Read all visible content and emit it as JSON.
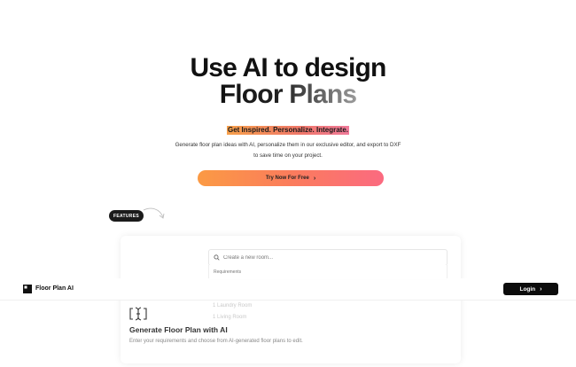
{
  "hero": {
    "title_line1": "Use AI to design",
    "title_line2": "Floor Plans",
    "tagline": "Get Inspired. Personalize. Integrate.",
    "description": "Generate floor plan ideas with AI, personalize them in our exclusive editor, and export to DXF to save time on your project.",
    "cta_label": "Try Now For Free",
    "cta_icon": "chevron-right-icon"
  },
  "features_badge": "FEATURES",
  "demo": {
    "search_placeholder": "Create a new room...",
    "dropdown_label": "Requirements",
    "faded_items": [
      "1 Laundry Room",
      "1 Living Room"
    ],
    "search_icon": "search-icon"
  },
  "feature": {
    "icon": "text-cursor-icon",
    "title": "Generate Floor Plan with AI",
    "description": "Enter your requirements and choose from AI-generated floor plans to edit."
  },
  "navbar": {
    "brand": "Floor Plan AI",
    "login_label": "Login"
  },
  "colors": {
    "accent_orange": "#fb9a44",
    "accent_pink": "#fb6a80",
    "dark": "#0c0c0c"
  }
}
